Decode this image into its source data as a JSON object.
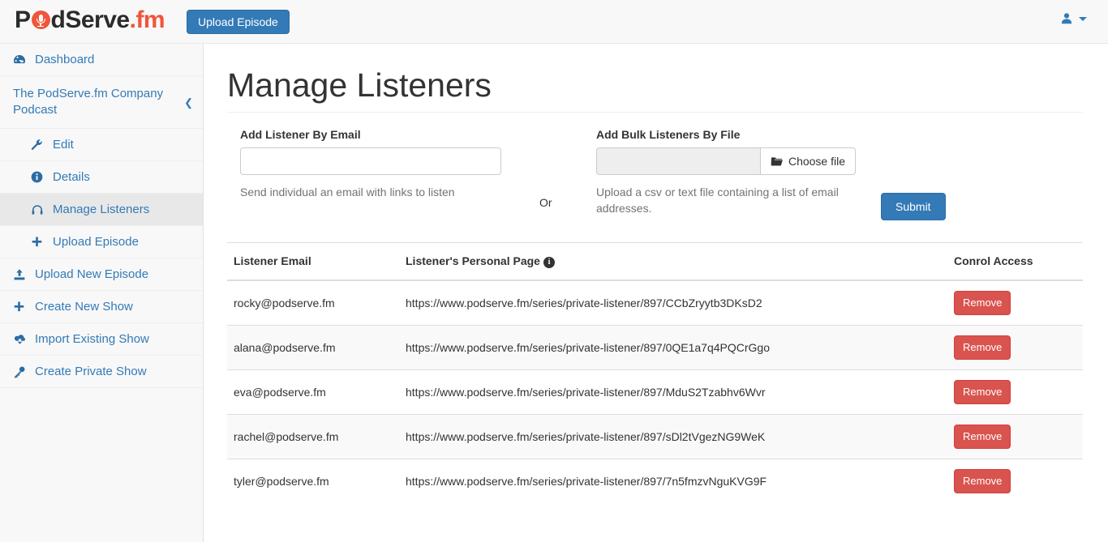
{
  "navbar": {
    "brand_before": "P",
    "brand_icon": "mic-circle-icon",
    "brand_middle": "dServe",
    "brand_dot": ".",
    "brand_suffix": "fm",
    "upload_episode_label": "Upload Episode",
    "user_icon": "user-icon",
    "caret_icon": "caret-down-icon"
  },
  "sidebar": {
    "items": [
      {
        "label": "Dashboard",
        "icon": "dashboard-icon",
        "level": "top",
        "active": false
      },
      {
        "label": "The PodServe.fm Company Podcast",
        "icon": "none",
        "level": "group",
        "active": false,
        "collapse_icon": "chevron-left-icon"
      },
      {
        "label": "Edit",
        "icon": "wrench-icon",
        "level": "sub",
        "active": false
      },
      {
        "label": "Details",
        "icon": "info-circle-icon",
        "level": "sub",
        "active": false
      },
      {
        "label": "Manage Listeners",
        "icon": "headphones-icon",
        "level": "sub",
        "active": true
      },
      {
        "label": "Upload Episode",
        "icon": "plus-icon",
        "level": "sub",
        "active": false
      },
      {
        "label": "Upload New Episode",
        "icon": "upload-icon",
        "level": "top",
        "active": false
      },
      {
        "label": "Create New Show",
        "icon": "plus-icon",
        "level": "top",
        "active": false
      },
      {
        "label": "Import Existing Show",
        "icon": "cloud-download-icon",
        "level": "top",
        "active": false
      },
      {
        "label": "Create Private Show",
        "icon": "key-icon",
        "level": "top",
        "active": false
      }
    ]
  },
  "main": {
    "page_title": "Manage Listeners",
    "form": {
      "email_label": "Add Listener By Email",
      "email_value": "",
      "email_placeholder": "",
      "email_help": "Send individual an email with links to listen",
      "or_label": "Or",
      "file_label": "Add Bulk Listeners By File",
      "file_value": "",
      "choose_file_label": "Choose file",
      "file_icon": "folder-open-icon",
      "file_help": "Upload a csv or text file containing a list of email addresses.",
      "submit_label": "Submit"
    },
    "table": {
      "headers": {
        "email": "Listener Email",
        "page": "Listener's Personal Page",
        "page_info_icon": "info-circle-icon",
        "access": "Conrol Access"
      },
      "rows": [
        {
          "email": "rocky@podserve.fm",
          "url": "https://www.podserve.fm/series/private-listener/897/CCbZryytb3DKsD2",
          "action": "Remove"
        },
        {
          "email": "alana@podserve.fm",
          "url": "https://www.podserve.fm/series/private-listener/897/0QE1a7q4PQCrGgo",
          "action": "Remove"
        },
        {
          "email": "eva@podserve.fm",
          "url": "https://www.podserve.fm/series/private-listener/897/MduS2Tzabhv6Wvr",
          "action": "Remove"
        },
        {
          "email": "rachel@podserve.fm",
          "url": "https://www.podserve.fm/series/private-listener/897/sDl2tVgezNG9WeK",
          "action": "Remove"
        },
        {
          "email": "tyler@podserve.fm",
          "url": "https://www.podserve.fm/series/private-listener/897/7n5fmzvNguKVG9F",
          "action": "Remove"
        }
      ]
    }
  },
  "colors": {
    "brand_accent": "#f0553a",
    "primary": "#337ab7",
    "danger": "#d9534f",
    "sidebar_bg": "#f8f8f8",
    "active_bg": "#e8e8e8"
  }
}
